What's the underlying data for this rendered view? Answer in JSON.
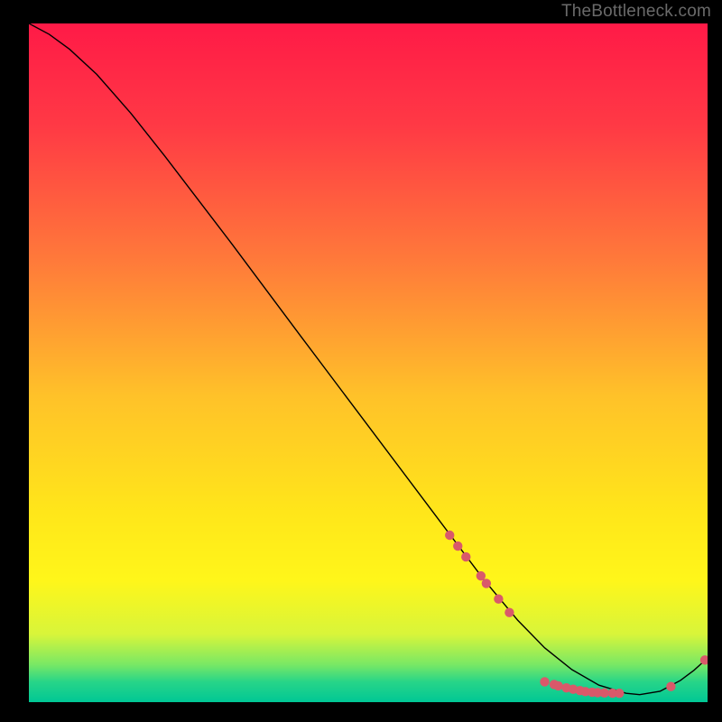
{
  "watermark": "TheBottleneck.com",
  "chart_data": {
    "type": "line",
    "title": "",
    "xlabel": "",
    "ylabel": "",
    "xlim": [
      0,
      100
    ],
    "ylim": [
      0,
      100
    ],
    "grid": false,
    "legend": false,
    "gradient_stops": [
      {
        "offset": 0.0,
        "color": "#ff1a47"
      },
      {
        "offset": 0.15,
        "color": "#ff3945"
      },
      {
        "offset": 0.35,
        "color": "#ff7a3a"
      },
      {
        "offset": 0.55,
        "color": "#ffc229"
      },
      {
        "offset": 0.72,
        "color": "#ffe61a"
      },
      {
        "offset": 0.82,
        "color": "#fff61a"
      },
      {
        "offset": 0.9,
        "color": "#d8f53a"
      },
      {
        "offset": 0.945,
        "color": "#78e865"
      },
      {
        "offset": 0.97,
        "color": "#28d588"
      },
      {
        "offset": 1.0,
        "color": "#00c795"
      }
    ],
    "series": [
      {
        "name": "curve",
        "stroke": "#000000",
        "stroke_width": 1.4,
        "points": [
          {
            "x": 0,
            "y": 100.0
          },
          {
            "x": 3,
            "y": 98.4
          },
          {
            "x": 6,
            "y": 96.2
          },
          {
            "x": 10,
            "y": 92.5
          },
          {
            "x": 15,
            "y": 86.8
          },
          {
            "x": 20,
            "y": 80.5
          },
          {
            "x": 30,
            "y": 67.4
          },
          {
            "x": 40,
            "y": 54.0
          },
          {
            "x": 50,
            "y": 40.7
          },
          {
            "x": 60,
            "y": 27.4
          },
          {
            "x": 67,
            "y": 18.1
          },
          {
            "x": 72,
            "y": 12.1
          },
          {
            "x": 76,
            "y": 8.0
          },
          {
            "x": 80,
            "y": 4.8
          },
          {
            "x": 84,
            "y": 2.5
          },
          {
            "x": 88,
            "y": 1.3
          },
          {
            "x": 90,
            "y": 1.1
          },
          {
            "x": 93,
            "y": 1.6
          },
          {
            "x": 96,
            "y": 3.2
          },
          {
            "x": 98,
            "y": 4.7
          },
          {
            "x": 100,
            "y": 6.5
          }
        ]
      }
    ],
    "markers": {
      "fill": "#d9596a",
      "radius": 5.2,
      "points": [
        {
          "x": 62.0,
          "y": 24.6
        },
        {
          "x": 63.2,
          "y": 23.0
        },
        {
          "x": 64.4,
          "y": 21.4
        },
        {
          "x": 66.6,
          "y": 18.6
        },
        {
          "x": 67.4,
          "y": 17.5
        },
        {
          "x": 69.2,
          "y": 15.2
        },
        {
          "x": 70.8,
          "y": 13.2
        },
        {
          "x": 76.0,
          "y": 3.0
        },
        {
          "x": 77.4,
          "y": 2.6
        },
        {
          "x": 78.0,
          "y": 2.4
        },
        {
          "x": 79.2,
          "y": 2.1
        },
        {
          "x": 80.2,
          "y": 1.9
        },
        {
          "x": 81.2,
          "y": 1.7
        },
        {
          "x": 82.0,
          "y": 1.55
        },
        {
          "x": 83.0,
          "y": 1.45
        },
        {
          "x": 83.8,
          "y": 1.4
        },
        {
          "x": 84.8,
          "y": 1.35
        },
        {
          "x": 86.0,
          "y": 1.32
        },
        {
          "x": 87.0,
          "y": 1.3
        },
        {
          "x": 94.6,
          "y": 2.3
        },
        {
          "x": 99.6,
          "y": 6.2
        }
      ]
    }
  }
}
